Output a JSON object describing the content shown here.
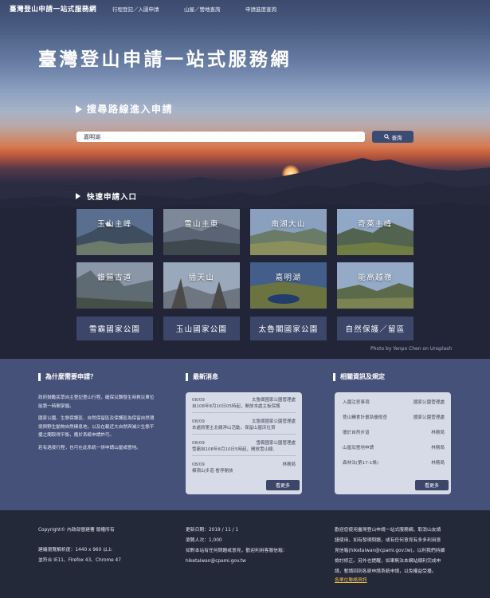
{
  "header": {
    "brand": "臺灣登山申請一站式服務網",
    "nav": [
      "行程登記／入園申請",
      "山屋／營地查詢",
      "申請進度查詢"
    ]
  },
  "hero": {
    "title": "臺灣登山申請一站式服務網",
    "search_heading": "搜尋路線進入申請",
    "search_value": "嘉明湖",
    "search_button": "查詢",
    "quick_heading": "快速申請入口",
    "photo_credit": "Photo by Yenpo Chen on Unsplash"
  },
  "quick_tiles": [
    {
      "label": "玉山主峰",
      "icon": "mountain-photo"
    },
    {
      "label": "雪山主東",
      "icon": "mountain-photo"
    },
    {
      "label": "南湖大山",
      "icon": "mountain-photo"
    },
    {
      "label": "奇萊主峰",
      "icon": "mountain-photo"
    },
    {
      "label": "錐麓古道",
      "icon": "mountain-photo"
    },
    {
      "label": "插天山",
      "icon": "mountain-photo"
    },
    {
      "label": "嘉明湖",
      "icon": "lake-photo"
    },
    {
      "label": "能高越嶺",
      "icon": "mountain-photo"
    }
  ],
  "park_tiles": [
    "雪霸國家公園",
    "玉山國家公園",
    "太魯閣國家公園",
    "自然保護／留區"
  ],
  "why": {
    "heading": "為什麼需要申請？",
    "paragraphs": [
      "政府鼓勵民眾自主登記登山行程，確保災難發生時救災單位能第一時間掌握。",
      "國家公園、生態保護區、自然保留區及保護區為保留自然環境與野生動物自然棲息地，以及在載近大自然與減少生態干擾之間取得平衡，應於系統申請許可。",
      "若有過夜行程，也可在此系統一併申請山屋或營地。"
    ]
  },
  "news": {
    "heading": "最新消息",
    "items": [
      {
        "date": "08/09",
        "source": "太魯閣國家公園管理處",
        "text": "自108年8月10日05時起，開放本處主板保護"
      },
      {
        "date": "08/09",
        "source": "太魯閣國家公園管理處",
        "text": "本處將第主北線淨山活動，保留山屋床位資"
      },
      {
        "date": "08/09",
        "source": "雪霸國家公園管理處",
        "text": "雪霸自108年8月10日5時起，開放雪山線、"
      },
      {
        "date": "08/09",
        "source": "林務局",
        "text": "橫嶺山步道-暫停開放"
      }
    ],
    "more": "看更多"
  },
  "links": {
    "heading": "相關資訊及規定",
    "items": [
      {
        "title": "入園注意事項",
        "source": "國家公園管理處"
      },
      {
        "title": "登山糧食計畫執優檢查",
        "source": "國家公園管理處"
      },
      {
        "title": "獵於自然步道",
        "source": "林務局"
      },
      {
        "title": "山屋及營地申請",
        "source": "林務局"
      },
      {
        "title": "森林法(第17-1條)",
        "source": "林務局"
      }
    ],
    "more": "看更多"
  },
  "footer": {
    "copyright": "Copyright© 內政部營建署 版權所有",
    "resolution": "建議瀏覽解析度：1440 x 960 以上",
    "browsers": "並符合 IE11、Firefox 43、Chrome 47",
    "updated": "更新日期：2019 / 11 / 1",
    "visitors": "瀏覽人次：1,000",
    "feedback": "如對本站有任何問題或意見，歡迎利用客服信箱：",
    "email": "hiketaiwan@cpami.gov.tw",
    "notice_lines": [
      "歡迎您使用臺灣登山申請一站式服務網，取消山友請",
      "謹使用，如有發現問題，或有任何意見有多多利用意",
      "見信箱(hiketaiwan@cpami.gov.tw)，以利我們持續",
      "檢討修正。另外也提醒，如果無法本網站順利完成申",
      "請，暫請回到各原申請系統申請，以免權益受擾。"
    ],
    "contact_link": "各單位聯絡資訊"
  },
  "colors": {
    "accent": "#3b4669",
    "info_bg": "#46517a",
    "footer_bg": "#242939",
    "card_bg": "#d6dbe7",
    "link": "#f0c050"
  }
}
